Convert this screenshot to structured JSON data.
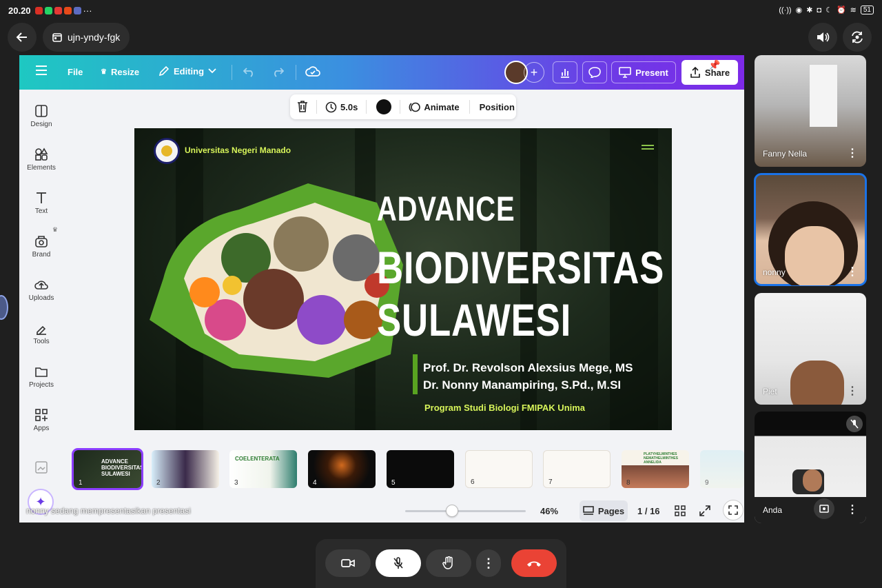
{
  "status_bar": {
    "time": "20.20",
    "more": "···",
    "battery": "51"
  },
  "meet": {
    "back_label": "back",
    "meeting_code": "ujn-yndy-fgk"
  },
  "canva": {
    "top": {
      "file": "File",
      "resize": "Resize",
      "editing": "Editing",
      "present": "Present",
      "share": "Share"
    },
    "sidebar": [
      {
        "label": "Design",
        "icon": "design-icon"
      },
      {
        "label": "Elements",
        "icon": "elements-icon"
      },
      {
        "label": "Text",
        "icon": "text-icon"
      },
      {
        "label": "Brand",
        "icon": "brand-icon"
      },
      {
        "label": "Uploads",
        "icon": "uploads-icon"
      },
      {
        "label": "Tools",
        "icon": "tools-icon"
      },
      {
        "label": "Projects",
        "icon": "projects-icon"
      },
      {
        "label": "Apps",
        "icon": "apps-icon"
      }
    ],
    "toolbar": {
      "duration": "5.0s",
      "animate": "Animate",
      "position": "Position",
      "color": "#111111"
    },
    "slide": {
      "university": "Universitas Negeri Manado",
      "title_1": "ADVANCE",
      "title_2": "BIODIVERSITAS",
      "title_3": "SULAWESI",
      "author_1": "Prof. Dr. Revolson Alexsius Mege, MS",
      "author_2": "Dr. Nonny Manampiring, S.Pd., M.SI",
      "program": "Program Studi Biologi FMIPAK Unima"
    },
    "thumbnails": [
      {
        "num": "1",
        "caption": "ADVANCE BIODIVERSITAS SULAWESI"
      },
      {
        "num": "2",
        "caption": ""
      },
      {
        "num": "3",
        "caption": "COELENTERATA"
      },
      {
        "num": "4",
        "caption": ""
      },
      {
        "num": "5",
        "caption": ""
      },
      {
        "num": "6",
        "caption": ""
      },
      {
        "num": "7",
        "caption": ""
      },
      {
        "num": "8",
        "caption": "PLATYHELMINTHES NEMATHELMINTHES ANNELIDA"
      },
      {
        "num": "9",
        "caption": ""
      }
    ],
    "bottom": {
      "presenting_text": "nonny sedang mempresentasikan presentasi",
      "zoom_value": 46,
      "zoom": "46%",
      "pages": "Pages",
      "page_count": "1 / 16"
    }
  },
  "participants": [
    {
      "name": "Fanny Nella"
    },
    {
      "name": "nonny"
    },
    {
      "name": "Piet"
    },
    {
      "name": "Anda"
    }
  ],
  "colors": {
    "accent_purple": "#8b3dff",
    "end_call": "#ea4335",
    "slide_green": "#59a321",
    "slide_yellow": "#d8f55a"
  }
}
